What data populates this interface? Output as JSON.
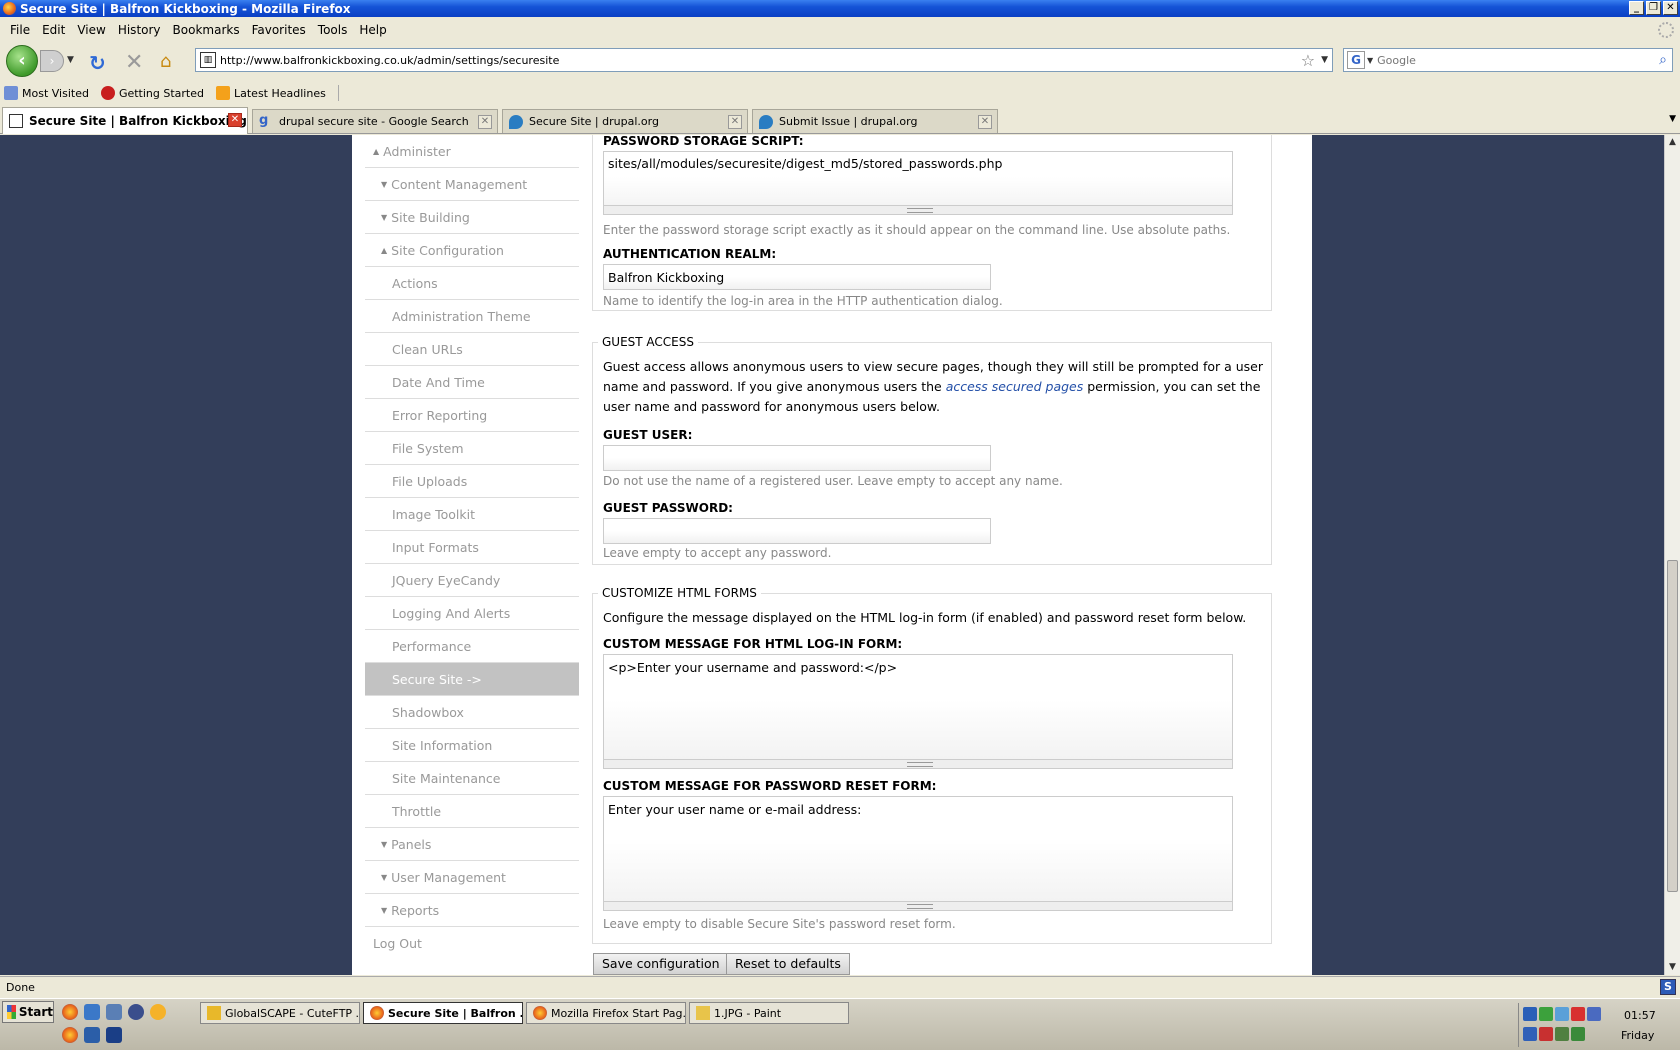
{
  "window": {
    "title": "Secure Site | Balfron Kickboxing - Mozilla Firefox"
  },
  "menu": [
    "File",
    "Edit",
    "View",
    "History",
    "Bookmarks",
    "Favorites",
    "Tools",
    "Help"
  ],
  "toolbar": {
    "url": "http://www.balfronkickboxing.co.uk/admin/settings/securesite",
    "search_placeholder": "Google"
  },
  "bookmarks": [
    "Most Visited",
    "Getting Started",
    "Latest Headlines"
  ],
  "tabs": [
    {
      "label": "Secure Site | Balfron Kickboxing",
      "active": true
    },
    {
      "label": "drupal secure site - Google Search",
      "active": false
    },
    {
      "label": "Secure Site | drupal.org",
      "active": false
    },
    {
      "label": "Submit Issue | drupal.org",
      "active": false
    }
  ],
  "sidebar": {
    "items": [
      {
        "label": "Administer",
        "level": 0,
        "marker": "up"
      },
      {
        "label": "Content Management",
        "level": 1,
        "marker": "down"
      },
      {
        "label": "Site Building",
        "level": 1,
        "marker": "down"
      },
      {
        "label": "Site Configuration",
        "level": 1,
        "marker": "up"
      },
      {
        "label": "Actions",
        "level": 2
      },
      {
        "label": "Administration Theme",
        "level": 2
      },
      {
        "label": "Clean URLs",
        "level": 2
      },
      {
        "label": "Date And Time",
        "level": 2
      },
      {
        "label": "Error Reporting",
        "level": 2
      },
      {
        "label": "File System",
        "level": 2
      },
      {
        "label": "File Uploads",
        "level": 2
      },
      {
        "label": "Image Toolkit",
        "level": 2
      },
      {
        "label": "Input Formats",
        "level": 2
      },
      {
        "label": "JQuery EyeCandy",
        "level": 2
      },
      {
        "label": "Logging And Alerts",
        "level": 2
      },
      {
        "label": "Performance",
        "level": 2
      },
      {
        "label": "Secure Site ->",
        "level": 2,
        "active": true
      },
      {
        "label": "Shadowbox",
        "level": 2
      },
      {
        "label": "Site Information",
        "level": 2
      },
      {
        "label": "Site Maintenance",
        "level": 2
      },
      {
        "label": "Throttle",
        "level": 2
      },
      {
        "label": "Panels",
        "level": 1,
        "marker": "down"
      },
      {
        "label": "User Management",
        "level": 1,
        "marker": "down"
      },
      {
        "label": "Reports",
        "level": 1,
        "marker": "down"
      },
      {
        "label": "Log Out",
        "level": 0
      }
    ]
  },
  "main": {
    "password_storage": {
      "label": "PASSWORD STORAGE SCRIPT:",
      "value": "sites/all/modules/securesite/digest_md5/stored_passwords.php",
      "description": "Enter the password storage script exactly as it should appear on the command line. Use absolute paths."
    },
    "auth_realm": {
      "label": "AUTHENTICATION REALM:",
      "value": "Balfron Kickboxing",
      "description": "Name to identify the log-in area in the HTTP authentication dialog."
    },
    "guest_access": {
      "legend": "GUEST ACCESS",
      "intro_before": "Guest access allows anonymous users to view secure pages, though they will still be prompted for a user name and password. If you give anonymous users the ",
      "intro_link": "access secured pages",
      "intro_after": " permission, you can set the user name and password for anonymous users below.",
      "user_label": "GUEST USER:",
      "user_value": "",
      "user_description": "Do not use the name of a registered user. Leave empty to accept any name.",
      "password_label": "GUEST PASSWORD:",
      "password_value": "",
      "password_description": "Leave empty to accept any password."
    },
    "customize": {
      "legend": "CUSTOMIZE HTML FORMS",
      "intro": "Configure the message displayed on the HTML log-in form (if enabled) and password reset form below.",
      "login_label": "CUSTOM MESSAGE FOR HTML LOG-IN FORM:",
      "login_value": "<p>Enter your username and password:</p>",
      "reset_label": "CUSTOM MESSAGE FOR PASSWORD RESET FORM:",
      "reset_value": "Enter your user name or e-mail address:",
      "reset_description": "Leave empty to disable Secure Site's password reset form."
    },
    "buttons": {
      "save": "Save configuration",
      "reset": "Reset to defaults"
    }
  },
  "status": {
    "text": "Done"
  },
  "taskbar": {
    "start": "Start",
    "tasks": [
      {
        "label": "GlobalSCAPE - CuteFTP ...",
        "active": false
      },
      {
        "label": "Secure Site | Balfron ...",
        "active": true
      },
      {
        "label": "Mozilla Firefox Start Pag...",
        "active": false
      },
      {
        "label": "1.JPG - Paint",
        "active": false
      }
    ],
    "clock": "01:57",
    "day": "Friday"
  }
}
